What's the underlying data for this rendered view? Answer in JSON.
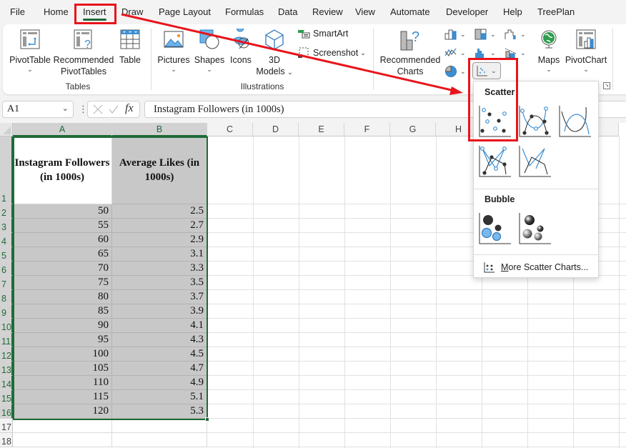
{
  "tabs": [
    {
      "label": "File"
    },
    {
      "label": "Home"
    },
    {
      "label": "Insert",
      "active": true
    },
    {
      "label": "Draw"
    },
    {
      "label": "Page Layout"
    },
    {
      "label": "Formulas"
    },
    {
      "label": "Data"
    },
    {
      "label": "Review"
    },
    {
      "label": "View"
    },
    {
      "label": "Automate"
    },
    {
      "label": "Developer"
    },
    {
      "label": "Help"
    },
    {
      "label": "TreePlan"
    }
  ],
  "ribbon": {
    "tables": {
      "group_label": "Tables",
      "pivottable": "PivotTable",
      "recommended_pivottables_line1": "Recommended",
      "recommended_pivottables_line2": "PivotTables",
      "table": "Table"
    },
    "illustrations": {
      "group_label": "Illustrations",
      "pictures": "Pictures",
      "shapes": "Shapes",
      "icons": "Icons",
      "models_line1": "3D",
      "models_line2": "Models",
      "smartart": "SmartArt",
      "screenshot": "Screenshot"
    },
    "charts": {
      "recommended_line1": "Recommended",
      "recommended_line2": "Charts",
      "maps": "Maps",
      "pivotchart": "PivotChart"
    },
    "chevron": "⌄"
  },
  "formula_bar": {
    "name_box": "A1",
    "fx_label": "fx",
    "content": "Instagram Followers (in 1000s)"
  },
  "sheet": {
    "columns": [
      "A",
      "B",
      "C",
      "D",
      "E",
      "F",
      "G",
      "H"
    ],
    "row_numbers": [
      "1",
      "2",
      "3",
      "4",
      "5",
      "6",
      "7",
      "8",
      "9",
      "10",
      "11",
      "12",
      "13",
      "14",
      "15",
      "16",
      "17",
      "18"
    ],
    "headers": {
      "a": "Instagram Followers (in 1000s)",
      "b": "Average Likes (in 1000s)"
    },
    "rows": [
      {
        "a": "50",
        "b": "2.5"
      },
      {
        "a": "55",
        "b": "2.7"
      },
      {
        "a": "60",
        "b": "2.9"
      },
      {
        "a": "65",
        "b": "3.1"
      },
      {
        "a": "70",
        "b": "3.3"
      },
      {
        "a": "75",
        "b": "3.5"
      },
      {
        "a": "80",
        "b": "3.7"
      },
      {
        "a": "85",
        "b": "3.9"
      },
      {
        "a": "90",
        "b": "4.1"
      },
      {
        "a": "95",
        "b": "4.3"
      },
      {
        "a": "100",
        "b": "4.5"
      },
      {
        "a": "105",
        "b": "4.7"
      },
      {
        "a": "110",
        "b": "4.9"
      },
      {
        "a": "115",
        "b": "5.1"
      },
      {
        "a": "120",
        "b": "5.3"
      }
    ]
  },
  "scatter_menu": {
    "scatter_title": "Scatter",
    "bubble_title": "Bubble",
    "more_prefix": "M",
    "more_rest": "ore Scatter Charts..."
  },
  "colors": {
    "accent_green": "#1e6b37",
    "annotation_red": "#e8141b",
    "chart_blue": "#3d8fd1",
    "selection_fill": "#c8c8c8"
  }
}
